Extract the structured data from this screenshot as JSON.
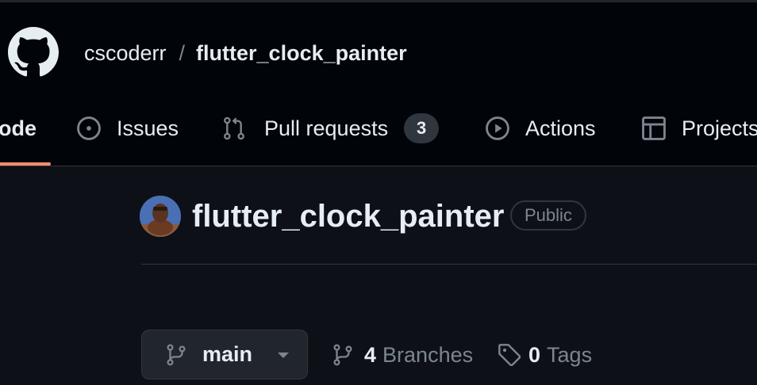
{
  "header": {
    "owner": "cscoderr",
    "separator": "/",
    "repo_name": "flutter_clock_painter"
  },
  "nav": {
    "tabs": [
      {
        "label": "ode",
        "icon": "code-icon",
        "selected": true
      },
      {
        "label": "Issues",
        "icon": "issue-icon"
      },
      {
        "label": "Pull requests",
        "icon": "pull-request-icon",
        "count": "3"
      },
      {
        "label": "Actions",
        "icon": "play-icon"
      },
      {
        "label": "Projects",
        "icon": "table-icon"
      }
    ]
  },
  "repo": {
    "title": "flutter_clock_painter",
    "visibility": "Public",
    "avatar": "avatar"
  },
  "branch": {
    "current": "main",
    "branches_count": "4",
    "branches_label": "Branches",
    "tags_count": "0",
    "tags_label": "Tags"
  },
  "colors": {
    "header_bg": "#010409",
    "page_bg": "#0d1117",
    "text_primary": "#e6edf3",
    "text_muted": "#7d8590",
    "border": "#30363d",
    "tab_underline": "#fd8c73",
    "counter_bg": "#30363d"
  }
}
